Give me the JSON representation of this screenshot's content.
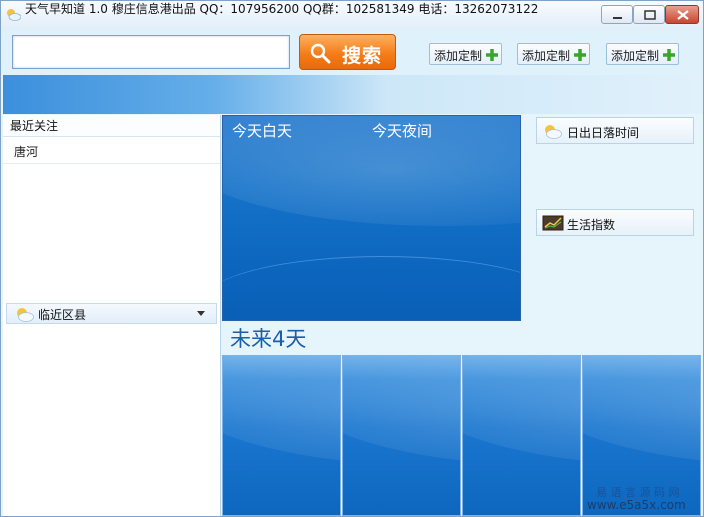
{
  "window": {
    "title": "天气早知道 1.0   穆庄信息港出品 QQ：107956200 QQ群：102581349 电话：13262073122",
    "controls": [
      "minimize",
      "maximize",
      "close"
    ]
  },
  "toolbar": {
    "search_value": "",
    "search_button_label": "搜索",
    "custom_buttons": [
      "添加定制",
      "添加定制",
      "添加定制"
    ]
  },
  "sidebar": {
    "recent_title": "最近关注",
    "recent_items": [
      "唐河"
    ],
    "nearby_title": "临近区县"
  },
  "today_panel": {
    "day_label": "今天白天",
    "night_label": "今天夜间"
  },
  "side_buttons": {
    "sunrise_label": "日出日落时间",
    "life_index_label": "生活指数"
  },
  "future": {
    "title": "未来4天",
    "cards": [
      "",
      "",
      "",
      ""
    ]
  },
  "watermark": {
    "line1": "易 语 言 源 码 网",
    "line2": "www.e5a5x.com"
  },
  "colors": {
    "panel_blue": "#0d67bf",
    "search_orange": "#f57d19",
    "plus_green": "#3aa52c",
    "title_blue": "#1a5fa8"
  },
  "icons": [
    "sun-cloud-icon",
    "search-icon",
    "plus-icon",
    "chevron-down-icon",
    "chart-icon",
    "close-icon",
    "minimize-icon",
    "maximize-icon"
  ]
}
